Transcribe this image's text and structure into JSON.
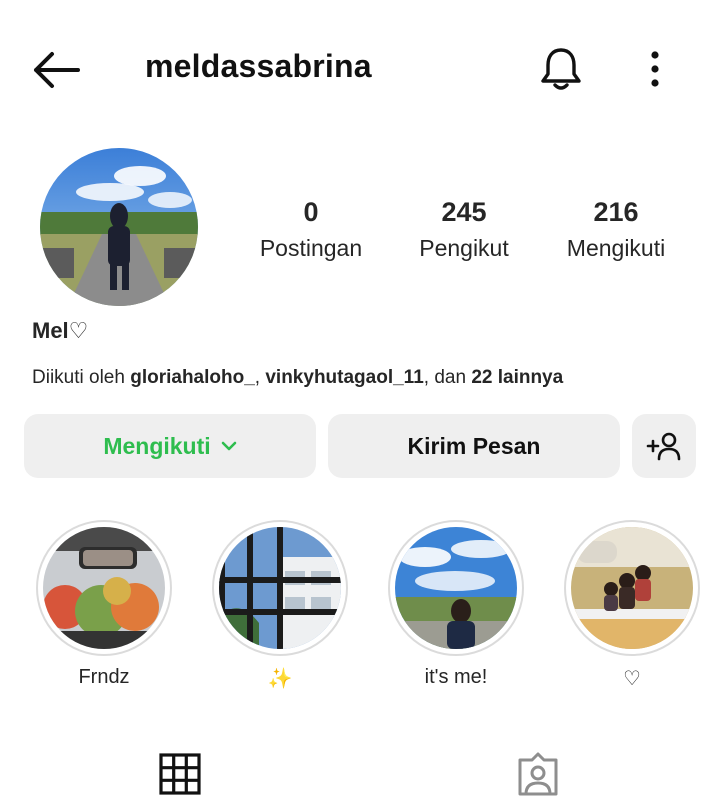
{
  "header": {
    "username": "meldassabrina",
    "back_icon": "arrow-left-icon",
    "bell_icon": "bell-icon",
    "more_icon": "more-vertical-icon"
  },
  "profile": {
    "display_name": "Mel♡",
    "stats": [
      {
        "value": "0",
        "label": "Postingan"
      },
      {
        "value": "245",
        "label": "Pengikut"
      },
      {
        "value": "216",
        "label": "Mengikuti"
      }
    ],
    "followed_by": {
      "prefix": "Diikuti oleh ",
      "user1": "gloriahaloho_",
      "sep": ", ",
      "user2": "vinkyhutagaol_11",
      "mid": ", dan ",
      "others": "22 lainnya"
    }
  },
  "actions": {
    "following_label": "Mengikuti",
    "message_label": "Kirim Pesan",
    "add_person_icon": "person-add-icon"
  },
  "highlights": [
    {
      "label": "Frndz"
    },
    {
      "label": "✨"
    },
    {
      "label": "it's me!"
    },
    {
      "label": "♡"
    }
  ],
  "tabs": [
    "grid-icon",
    "tagged-icon"
  ],
  "colors": {
    "accent_green": "#2ebd4e",
    "button_bg": "#efefef",
    "text": "#262626"
  }
}
